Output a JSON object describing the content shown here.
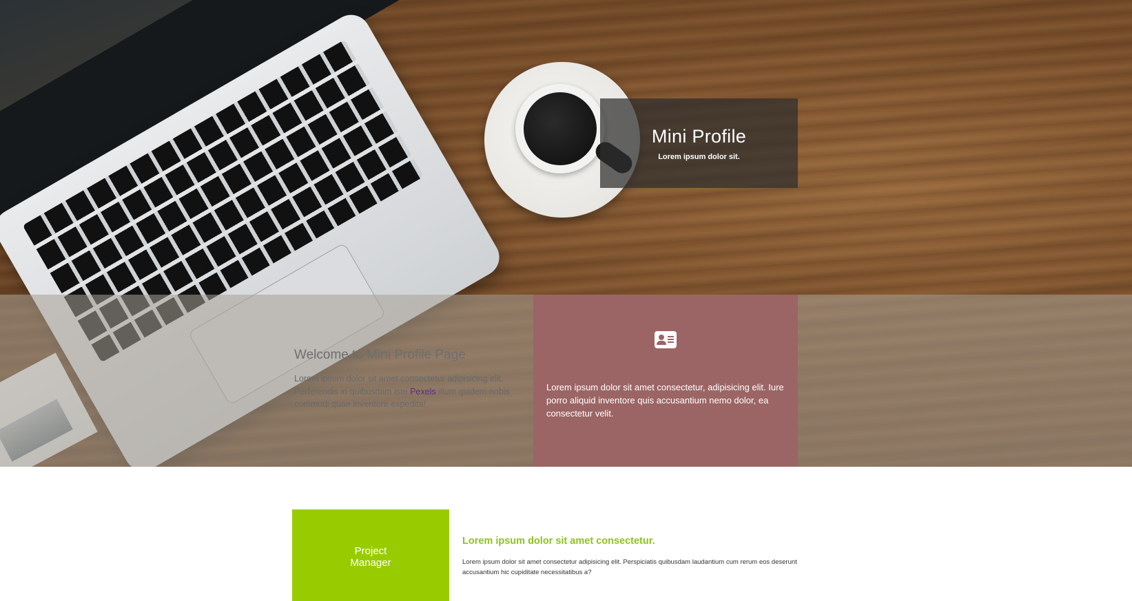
{
  "hero": {
    "title": "Mini Profile",
    "subtitle": "Lorem ipsum dolor sit."
  },
  "welcome": {
    "heading": "Welcome to Mini Profile Page",
    "text_before_link": "Lorem ipsum dolor sit amet consectetur adipisicing elit. Perferendis in quibusdam iste ",
    "link_label": "Pexels",
    "text_after_link": " illum quidem nobis commodi quae inventore expedita!"
  },
  "card": {
    "icon": "id-card-icon",
    "text": "Lorem ipsum dolor sit amet consectetur, adipisicing elit. Iure porro aliquid inventore quis accusantium nemo dolor, ea consectetur velit."
  },
  "role": {
    "line1": "Project",
    "line2": "Manager"
  },
  "intro": {
    "heading": "Lorem ipsum dolor sit amet consectetur.",
    "text": "Lorem ipsum dolor sit amet consectetur adipisicing elit. Perspiciatis quibusdam laudantium cum rerum eos deserunt accusantium hic cupiditate necessitatibus a?"
  },
  "colors": {
    "card_bg": "#9c6565",
    "accent_green": "#99cc00",
    "heading_green": "#8cc31f",
    "link_purple": "#5b2a86"
  }
}
